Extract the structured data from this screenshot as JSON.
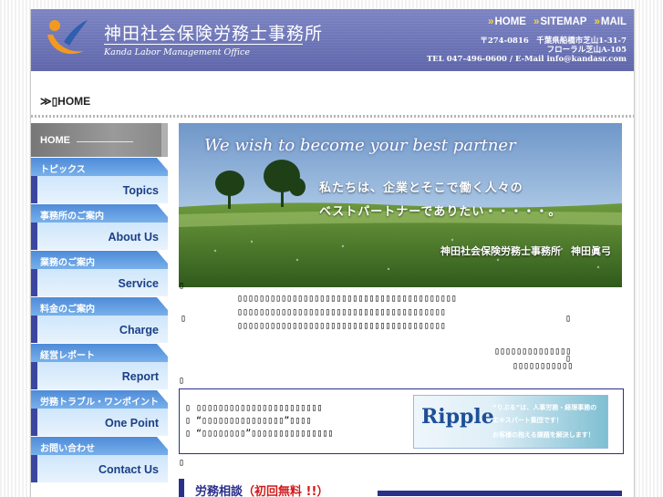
{
  "header": {
    "title_jp": "神田社会保険労務士事務所",
    "title_en": "Kanda Labor Management Office",
    "topnav": [
      {
        "arrow": "»",
        "label": "HOME"
      },
      {
        "arrow": "»",
        "label": "SITEMAP"
      },
      {
        "arrow": "»",
        "label": "MAIL"
      }
    ],
    "address": {
      "line1": "〒274-0816　千葉県船橋市芝山1-31-7",
      "line2": "フローラル芝山A-105",
      "line3": "TEL 047-496-0600 / E-Mail info@kandasr.com"
    }
  },
  "breadcrumb": "≫▯HOME",
  "sidebar": {
    "home": "HOME",
    "items": [
      {
        "jp": "トピックス",
        "en": "Topics"
      },
      {
        "jp": "事務所のご案内",
        "en": "About Us"
      },
      {
        "jp": "業務のご案内",
        "en": "Service"
      },
      {
        "jp": "料金のご案内",
        "en": "Charge"
      },
      {
        "jp": "経営レポート",
        "en": "Report"
      },
      {
        "jp": "労務トラブル・ワンポイント",
        "en": "One Point"
      },
      {
        "jp": "お問い合わせ",
        "en": "Contact Us"
      }
    ]
  },
  "hero": {
    "tagline_en": "We wish to become your best partner",
    "line1": "私たちは、企業とそこで働く人々の",
    "line2": "ベストパートナーでありたい・・・・・。",
    "signature": "神田社会保険労務士事務所　神田眞弓"
  },
  "body_text": {
    "stray1": "▯",
    "para1": "▯▯▯▯▯▯▯▯▯▯▯▯▯▯▯▯▯▯▯▯▯▯▯▯▯▯▯▯▯▯▯▯▯▯▯▯▯▯▯▯",
    "para2": "▯▯▯▯▯▯▯▯▯▯▯▯▯▯▯▯▯▯▯▯▯▯▯▯▯▯▯▯▯▯▯▯▯▯▯▯▯▯",
    "para3": "▯▯▯▯▯▯▯▯▯▯▯▯▯▯▯▯▯▯▯▯▯▯▯▯▯▯▯▯▯▯▯▯▯▯▯▯▯▯",
    "left_mark": "▯",
    "right_mark": "▯",
    "sig1": "▯▯▯▯▯▯▯▯▯▯▯▯▯▯",
    "sig2": "▯▯▯▯▯▯▯▯▯▯▯",
    "sig_mark": "▯",
    "stray2": "▯",
    "stray3": "▯"
  },
  "ripple_box": {
    "line1": "▯ ▯▯▯▯▯▯▯▯▯▯▯▯▯▯▯▯▯▯▯▯▯▯▯",
    "line2": "▯ “▯▯▯▯▯▯▯▯▯▯▯▯▯▯▯”▯▯▯▯",
    "line3": "▯ “▯▯▯▯▯▯▯▯”▯▯▯▯▯▯▯▯▯▯▯▯▯▯▯",
    "banner_word": "Ripple",
    "banner_sub1": "“りぷる”は、人事労務・経理事務の",
    "banner_sub2": "エキスパート集団です！",
    "banner_sub3": "お客様の抱える課題を解決します！"
  },
  "consult": {
    "label": "労務相談",
    "free": "（初回無料 !!）"
  },
  "colors": {
    "header_bg": "#6c74b7",
    "nav_dark": "#3b46a0",
    "nav_blue": "#4f8bd8",
    "accent_navy": "#2a2f8a",
    "accent_red": "#d21a1a"
  }
}
